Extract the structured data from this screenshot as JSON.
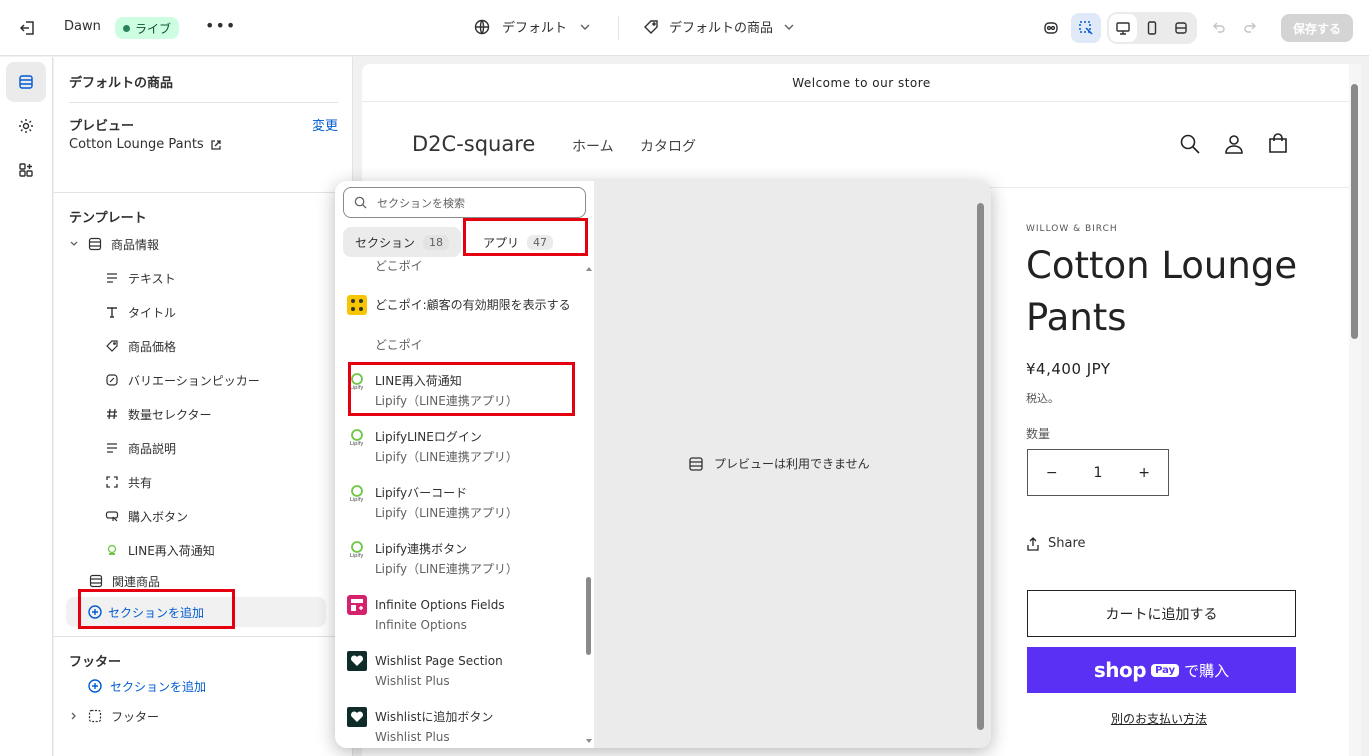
{
  "topbar": {
    "theme_name": "Dawn",
    "live_badge": "ライブ",
    "more": "•••",
    "template_select": "デフォルト",
    "product_select": "デフォルトの商品",
    "save_label": "保存する"
  },
  "sidebar": {
    "title": "デフォルトの商品",
    "preview_label": "プレビュー",
    "change_link": "変更",
    "preview_value": "Cotton Lounge Pants",
    "template_label": "テンプレート",
    "tree": {
      "product_info": "商品情報",
      "blocks": [
        {
          "label": "テキスト",
          "icon": "text-icon"
        },
        {
          "label": "タイトル",
          "icon": "title-icon"
        },
        {
          "label": "商品価格",
          "icon": "price-tag-icon"
        },
        {
          "label": "バリエーションピッカー",
          "icon": "variant-icon"
        },
        {
          "label": "数量セレクター",
          "icon": "hash-icon"
        },
        {
          "label": "商品説明",
          "icon": "text-icon"
        },
        {
          "label": "共有",
          "icon": "share-frame-icon"
        },
        {
          "label": "購入ボタン",
          "icon": "buy-button-icon"
        },
        {
          "label": "LINE再入荷通知",
          "icon": "lipify-icon"
        }
      ],
      "related": "関連商品"
    },
    "add_section": "セクションを追加",
    "footer_label": "フッター",
    "footer_add_section": "セクションを追加",
    "footer_item": "フッター"
  },
  "popover": {
    "search_placeholder": "セクションを検索",
    "tab_sections": "セクション",
    "tab_sections_count": "18",
    "tab_apps": "アプリ",
    "tab_apps_count": "47",
    "partial_top": "どこポイ",
    "apps": [
      {
        "name": "どこポイ:顧客の有効期限を表示する",
        "vendor": "どこポイ",
        "logo": "dokopoi-logo"
      },
      {
        "name": "LINE再入荷通知",
        "vendor": "Lipify（LINE連携アプリ）",
        "logo": "lipify-logo"
      },
      {
        "name": "LipifyLINEログイン",
        "vendor": "Lipify（LINE連携アプリ）",
        "logo": "lipify-logo"
      },
      {
        "name": "Lipifyバーコード",
        "vendor": "Lipify（LINE連携アプリ）",
        "logo": "lipify-logo"
      },
      {
        "name": "Lipify連携ボタン",
        "vendor": "Lipify（LINE連携アプリ）",
        "logo": "lipify-logo"
      },
      {
        "name": "Infinite Options Fields",
        "vendor": "Infinite Options",
        "logo": "infinite-options-logo"
      },
      {
        "name": "Wishlist Page Section",
        "vendor": "Wishlist Plus",
        "logo": "wishlist-logo"
      },
      {
        "name": "Wishlistに追加ボタン",
        "vendor": "Wishlist Plus",
        "logo": "wishlist-logo"
      }
    ],
    "unavailable": "プレビューは利用できません"
  },
  "store": {
    "announcement": "Welcome to our store",
    "logo": "D2C-square",
    "nav": [
      "ホーム",
      "カタログ"
    ],
    "vendor": "WILLOW & BIRCH",
    "product_title": "Cotton Lounge Pants",
    "price": "¥4,400 JPY",
    "tax_note": "税込。",
    "qty_label": "数量",
    "qty_value": "1",
    "qty_minus": "−",
    "qty_plus": "+",
    "share": "Share",
    "add_to_cart": "カートに追加する",
    "shop_word": "shop",
    "pay_pill": "Pay",
    "buy_now": "で購入",
    "other_payment": "別のお支払い方法"
  },
  "colors": {
    "accent": "#005bd3",
    "live_bg": "#cdfee1",
    "highlight": "#e4000f",
    "shop_pay": "#5a31f4"
  }
}
